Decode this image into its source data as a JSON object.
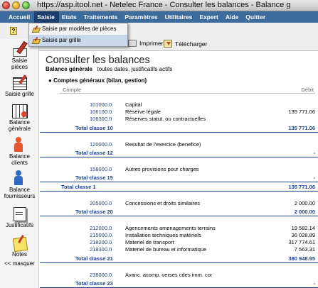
{
  "window": {
    "title": "https://asp.itool.net - Netelec France - Consulter les balances - Balance g"
  },
  "menubar": {
    "items": [
      "Accueil",
      "Saisie",
      "Etats",
      "Traitements",
      "Paramètres",
      "Utilitaires",
      "Expert",
      "Aide",
      "Quitter"
    ],
    "active_index": 1
  },
  "submenu": {
    "items": [
      "Saisie par modèles de pièces",
      "Saisie par grille"
    ],
    "highlighted_index": 1
  },
  "toolbar": {
    "print_label": "Imprimer",
    "download_label": "Télécharger"
  },
  "sidebar": {
    "items": [
      {
        "label1": "Saisie",
        "label2": "pièces",
        "icon": "pen-icon"
      },
      {
        "label1": "Saisie grille",
        "label2": "",
        "icon": "grid-icon"
      },
      {
        "label1": "Balance",
        "label2": "générale",
        "icon": "balance-icon"
      },
      {
        "label1": "Balance",
        "label2": "clients",
        "icon": "client-icon"
      },
      {
        "label1": "Balance",
        "label2": "fournisseurs",
        "icon": "supplier-icon"
      },
      {
        "label1": "Justificatifs",
        "label2": "",
        "icon": "documents-icon"
      },
      {
        "label1": "Notes",
        "label2": "",
        "icon": "notes-icon"
      }
    ],
    "hide_label": "<< masquer"
  },
  "page": {
    "title": "Consulter les balances",
    "subtitle_bold": "Balance générale",
    "subtitle_rest": "toutes dates, justificatifs actifs",
    "section": "Comptes généraux (bilan, gestion)",
    "col_compte": "Compte",
    "col_debit": "Débit"
  },
  "rows": [
    {
      "type": "acct",
      "code": "101000.0",
      "label": "Capital",
      "amount": ""
    },
    {
      "type": "acct",
      "code": "106100.0",
      "label": "Réserve légale",
      "amount": "135 771.06"
    },
    {
      "type": "acct",
      "code": "106300.0",
      "label": "Réserves statut. ou contractuelles",
      "amount": ""
    },
    {
      "type": "total",
      "label": "Total classe 10",
      "amount": "135 771.06"
    },
    {
      "type": "acct",
      "code": "120000.0",
      "label": "Resultat de l'exercice (benefice)",
      "amount": ""
    },
    {
      "type": "total",
      "label": "Total classe 12",
      "amount": "-"
    },
    {
      "type": "acct",
      "code": "158000.0",
      "label": "Autres provisions pour charges",
      "amount": ""
    },
    {
      "type": "total",
      "label": "Total classe 15",
      "amount": "-"
    },
    {
      "type": "total_big",
      "label": "Total classe 1",
      "amount": "135 771.06"
    },
    {
      "type": "acct",
      "code": "205000.0",
      "label": "Concessions et droits similaires",
      "amount": "2 000.00"
    },
    {
      "type": "total",
      "label": "Total classe 20",
      "amount": "2 000.00"
    },
    {
      "type": "acct",
      "code": "212000.0",
      "label": "Agencements amenagements terrains",
      "amount": "19 582.14"
    },
    {
      "type": "acct",
      "code": "215000.0",
      "label": "Installation techniques matériels",
      "amount": "36 028.89"
    },
    {
      "type": "acct",
      "code": "218200.0",
      "label": "Materiel de transport",
      "amount": "317 774.61"
    },
    {
      "type": "acct",
      "code": "218300.0",
      "label": "Materiel de bureau et informatique",
      "amount": "7 563.31"
    },
    {
      "type": "total",
      "label": "Total classe 21",
      "amount": "380 948.95"
    },
    {
      "type": "acct",
      "code": "238000.0",
      "label": "Avanc. acomp. verses cdes imm. cor",
      "amount": ""
    },
    {
      "type": "total",
      "label": "Total classe 23",
      "amount": "-"
    }
  ]
}
